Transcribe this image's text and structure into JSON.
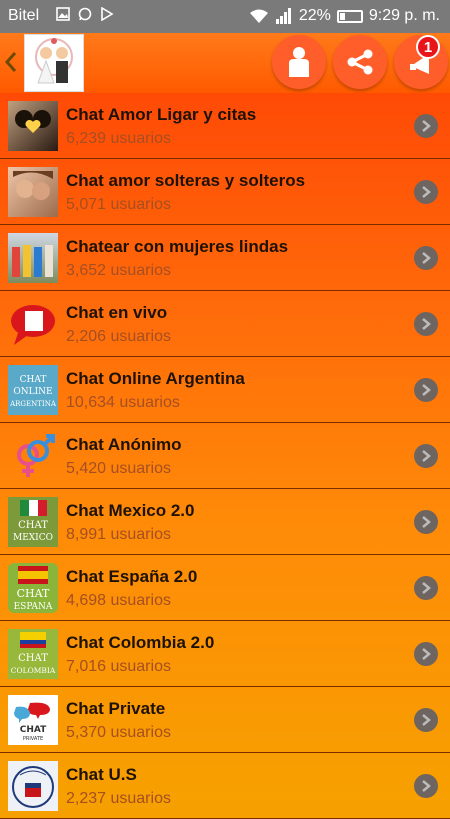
{
  "status_bar": {
    "carrier": "Bitel",
    "battery": "22%",
    "battery_level": 0.22,
    "time": "9:29 p. m.",
    "notification_icons": [
      "gallery-icon",
      "whatsapp-icon",
      "play-icon"
    ],
    "system_icons": [
      "wifi-icon",
      "signal-icon",
      "battery-icon"
    ]
  },
  "app_bar": {
    "back_icon": "chevron-left-icon",
    "logo_icon": "couple-wedding-logo",
    "buttons": [
      {
        "name": "profile-button",
        "icon": "person-icon"
      },
      {
        "name": "share-button",
        "icon": "share-icon"
      },
      {
        "name": "notifications-button",
        "icon": "megaphone-icon",
        "badge": "1"
      }
    ]
  },
  "rooms": [
    {
      "title": "Chat Amor Ligar y citas",
      "users": "6,239 usuarios",
      "thumb": "couple-heart-photo"
    },
    {
      "title": "Chat amor solteras y solteros",
      "users": "5,071 usuarios",
      "thumb": "couple-photo"
    },
    {
      "title": "Chatear con mujeres lindas",
      "users": "3,652 usuarios",
      "thumb": "women-group-photo"
    },
    {
      "title": "Chat en vivo",
      "users": "2,206 usuarios",
      "thumb": "speech-bubble-icon"
    },
    {
      "title": "Chat Online Argentina",
      "users": "10,634 usuarios",
      "thumb": "argentina-badge",
      "thumb_text": [
        "CHAT",
        "ONLINE",
        "ARGENTINA"
      ]
    },
    {
      "title": "Chat Anónimo",
      "users": "5,420 usuarios",
      "thumb": "gender-symbols-icon"
    },
    {
      "title": "Chat Mexico 2.0",
      "users": "8,991 usuarios",
      "thumb": "mexico-flag-badge",
      "thumb_text": [
        "CHAT",
        "MEXICO"
      ]
    },
    {
      "title": "Chat España 2.0",
      "users": "4,698 usuarios",
      "thumb": "spain-flag-badge",
      "thumb_text": [
        "CHAT",
        "ESPANA"
      ]
    },
    {
      "title": "Chat Colombia 2.0",
      "users": "7,016 usuarios",
      "thumb": "colombia-flag-badge",
      "thumb_text": [
        "CHAT",
        "COLOMBIA"
      ]
    },
    {
      "title": "Chat Private",
      "users": "5,370 usuarios",
      "thumb": "chat-private-logo",
      "thumb_text": [
        "CHAT",
        "PRIVATE"
      ]
    },
    {
      "title": "Chat U.S",
      "users": "2,237 usuarios",
      "thumb": "united-states-seal"
    }
  ],
  "colors": {
    "status_bar": "#7a7a7a",
    "app_bar": "#ff5a00",
    "list_top": "#ff4a06",
    "list_bottom": "#f7a000",
    "title_text": "#1e1206",
    "count_text": "#a54f22",
    "divider": "#7a2e00",
    "chevron_bg": "#6e6460",
    "badge": "#e8141a"
  }
}
